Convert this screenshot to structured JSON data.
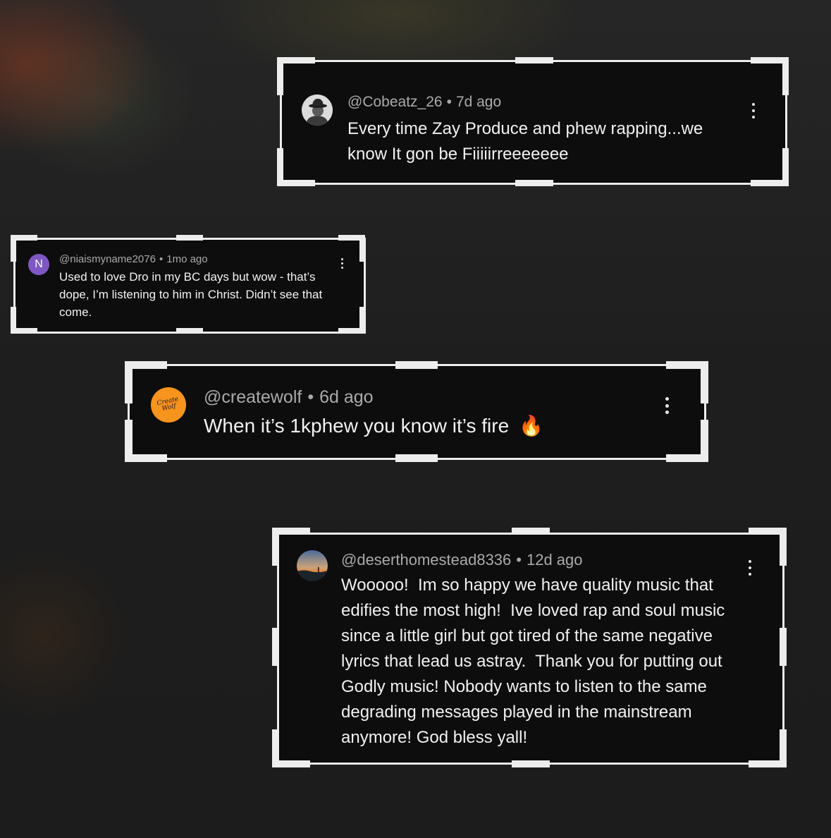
{
  "comments": [
    {
      "handle": "@Cobeatz_26",
      "time": "7d ago",
      "text": "Every time Zay Produce and phew rapping...we know It gon be Fiiiiirreeeeeee",
      "avatar_icon": "hat-person-avatar-icon"
    },
    {
      "handle": "@niaismyname2076",
      "time": "1mo ago",
      "text": "Used to love Dro in my BC days but wow - that’s dope, I’m listening to him in Christ. Didn’t see that come.",
      "avatar_letter": "N",
      "avatar_color": "#7e57c2"
    },
    {
      "handle": "@createwolf",
      "time": "6d ago",
      "text": "When it’s 1kphew you know it’s fire",
      "emoji": "🔥",
      "avatar_text": "Create Wolf",
      "avatar_color": "#f7941d"
    },
    {
      "handle": "@deserthomestead8336",
      "time": "12d ago",
      "text": "Wooooo!  Im so happy we have quality music that edifies the most high!  Ive loved rap and soul music since a little girl but got tired of the same negative lyrics that lead us astray.  Thank you for putting out Godly music! Nobody wants to listen to the same degrading messages played in the mainstream anymore! God bless yall!",
      "avatar_icon": "sunset-landscape-avatar-icon"
    }
  ],
  "separator": "•",
  "colors": {
    "card_background": "#0d0d0d",
    "frame": "#ededed",
    "meta_text": "#aaaaaa",
    "body_text": "#f1f1f1"
  }
}
